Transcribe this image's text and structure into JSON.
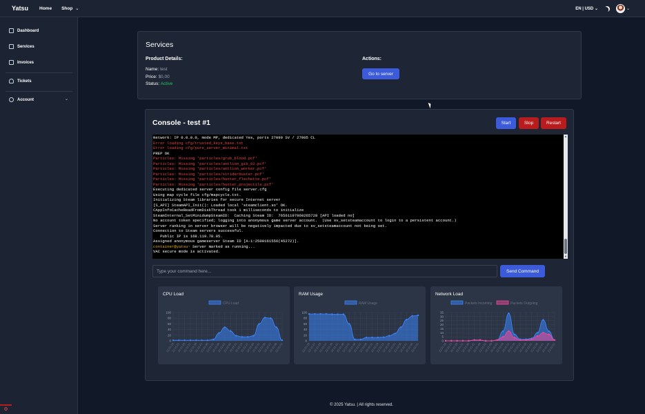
{
  "header": {
    "brand": "Yatsu",
    "nav": [
      {
        "label": "Home"
      },
      {
        "label": "Shop"
      }
    ],
    "locale": "EN | USD"
  },
  "sidebar": {
    "items": [
      {
        "label": "Dashboard",
        "icon": "dashboard-icon"
      },
      {
        "label": "Services",
        "icon": "services-icon"
      },
      {
        "label": "Invoices",
        "icon": "invoices-icon"
      },
      {
        "label": "Tickets",
        "icon": "headset-icon"
      },
      {
        "label": "Account",
        "icon": "gear-icon"
      }
    ]
  },
  "services": {
    "title": "Services",
    "product_details_label": "Product Details:",
    "name_label": "Name:",
    "name_value": "test",
    "price_label": "Price:",
    "price_value": "$0,00",
    "status_label": "Status:",
    "status_value": "Active",
    "actions_label": "Actions:",
    "go_button": "Go to server"
  },
  "console": {
    "title": "Console - test #1",
    "start_button": "Start",
    "stop_button": "Stop",
    "restart_button": "Restart",
    "lines": [
      {
        "text": "Network: IP 0.0.0.0, mode MP, dedicated Yes, ports 27099 SV / 27005 CL",
        "type": "normal"
      },
      {
        "text": "Error loading cfg/trusted_keys_base.txt",
        "type": "error"
      },
      {
        "text": "Error loading cfg/pure_server_minimal.txt",
        "type": "error"
      },
      {
        "text": "PREP OK",
        "type": "normal"
      },
      {
        "text": "Particles: Missing 'particles/grub_blood.pcf'",
        "type": "error"
      },
      {
        "text": "Particles: Missing 'particles/antlion_gib_02.pcf'",
        "type": "error"
      },
      {
        "text": "Particles: Missing 'particles/antlion_worker.pcf'",
        "type": "error"
      },
      {
        "text": "Particles: Missing 'particles/striderbuster.pcf'",
        "type": "error"
      },
      {
        "text": "Particles: Missing 'particles/hunter_flechette.pcf'",
        "type": "error"
      },
      {
        "text": "Particles: Missing 'particles/hunter_projectile.pcf'",
        "type": "error"
      },
      {
        "text": "Executing dedicated server config file server.cfg",
        "type": "normal"
      },
      {
        "text": "Using map cycle file cfg/mapcycle.txt.",
        "type": "normal"
      },
      {
        "text": "Initializing Steam libraries for secure Internet server",
        "type": "normal"
      },
      {
        "text": "[S_API] SteamAPI_Init(): Loaded local 'steamclient.so' OK.",
        "type": "normal"
      },
      {
        "text": "CAppInfoCacheReadFromDiskThread took 1 milliseconds to initialize",
        "type": "normal"
      },
      {
        "text": "SteamInternal_SetMinidumpSteamID:  Caching Steam ID:  76561197960265728 [API loaded no]",
        "type": "normal"
      },
      {
        "text": "No account token specified; logging into anonymous game server account.  (Use sv_setsteamaccount to login to a persistent account.)",
        "type": "normal"
      },
      {
        "text": "Server ranking in server browser will be negatively impacted due to sv_setsteamaccount not being set.",
        "type": "normal"
      },
      {
        "text": "Connection to Steam servers successful.",
        "type": "normal"
      },
      {
        "text": "   Public IP is 168.119.78.95.",
        "type": "normal"
      },
      {
        "text": "Assigned anonymous gameserver Steam ID [A-1:2500161556(45272)].",
        "type": "normal"
      },
      {
        "text": "container@yatsu~ Server marked as running...",
        "type": "prompt"
      },
      {
        "text": "VAC secure mode is activated.",
        "type": "normal"
      }
    ],
    "input_placeholder": "Type your command here...",
    "send_button": "Send Command"
  },
  "charts": {
    "cpu_title": "CPU Load",
    "ram_title": "RAM Usage",
    "net_title": "Network Load"
  },
  "chart_data": [
    {
      "type": "area",
      "title": "CPU Load",
      "ylim": [
        0,
        100
      ],
      "yticks": [
        "100",
        "80",
        "60",
        "40",
        "20",
        "0"
      ],
      "x": [
        "22:31:16",
        "22:31:21",
        "22:31:26",
        "22:31:31",
        "22:31:36",
        "22:31:41",
        "22:31:46",
        "22:31:51",
        "22:31:56",
        "22:32:01",
        "22:32:06",
        "22:32:11",
        "22:32:16",
        "22:32:21",
        "22:32:26",
        "22:32:31",
        "22:32:36",
        "22:32:41",
        "22:32:46",
        "22:32:51"
      ],
      "series": [
        {
          "name": "CPU Load",
          "color": "#3b82f6",
          "values": [
            2,
            2,
            2,
            2,
            2,
            2,
            2,
            5,
            28,
            48,
            35,
            18,
            14,
            14,
            18,
            60,
            82,
            80,
            48,
            2
          ]
        }
      ],
      "legend": "top",
      "grid": true
    },
    {
      "type": "area",
      "title": "RAM Usage",
      "ylim": [
        0,
        100
      ],
      "yticks": [
        "100",
        "80",
        "60",
        "40",
        "20",
        "0"
      ],
      "x": [
        "22:31:16",
        "22:31:21",
        "22:31:26",
        "22:31:31",
        "22:31:36",
        "22:31:41",
        "22:31:46",
        "22:31:51",
        "22:31:56",
        "22:32:01",
        "22:32:06",
        "22:32:11",
        "22:32:16",
        "22:32:21",
        "22:32:26",
        "22:32:31",
        "22:32:36",
        "22:32:41",
        "22:32:46",
        "22:32:51"
      ],
      "series": [
        {
          "name": "RAM Usage",
          "color": "#3b82f6",
          "values": [
            95,
            95,
            95,
            95,
            94,
            94,
            94,
            60,
            5,
            5,
            12,
            12,
            12,
            13,
            18,
            26,
            48,
            75,
            88,
            90
          ]
        }
      ],
      "legend": "top",
      "grid": true
    },
    {
      "type": "area",
      "title": "Network Load",
      "ylim": [
        0,
        35
      ],
      "yticks": [
        "35",
        "30",
        "25",
        "20",
        "15",
        "10",
        "5",
        "0"
      ],
      "x": [
        "22:31:16",
        "22:31:21",
        "22:31:26",
        "22:31:31",
        "22:31:36",
        "22:31:41",
        "22:31:46",
        "22:31:51",
        "22:31:56",
        "22:32:01",
        "22:32:06",
        "22:32:11",
        "22:32:16",
        "22:32:21",
        "22:32:26",
        "22:32:31",
        "22:32:36",
        "22:32:41",
        "22:32:46",
        "22:32:51"
      ],
      "series": [
        {
          "name": "Packets Incoming",
          "color": "#3b82f6",
          "values": [
            0,
            0,
            0,
            0,
            0,
            1,
            1,
            0,
            0,
            1,
            12,
            34,
            8,
            2,
            2,
            3,
            10,
            26,
            12,
            1
          ]
        },
        {
          "name": "Packets Outgoing",
          "color": "#ec4899",
          "values": [
            0,
            0,
            0,
            0,
            0,
            1,
            1,
            0,
            0,
            1,
            5,
            12,
            4,
            1,
            1,
            2,
            6,
            10,
            8,
            1
          ]
        }
      ],
      "legend": "top",
      "grid": true
    }
  ],
  "footer": "© 2025 Yatsu. | All rights reserved.",
  "colors": {
    "accent": "#3b5bdb",
    "danger": "#b91c1c",
    "success": "#22c55e",
    "background": "#111827"
  }
}
